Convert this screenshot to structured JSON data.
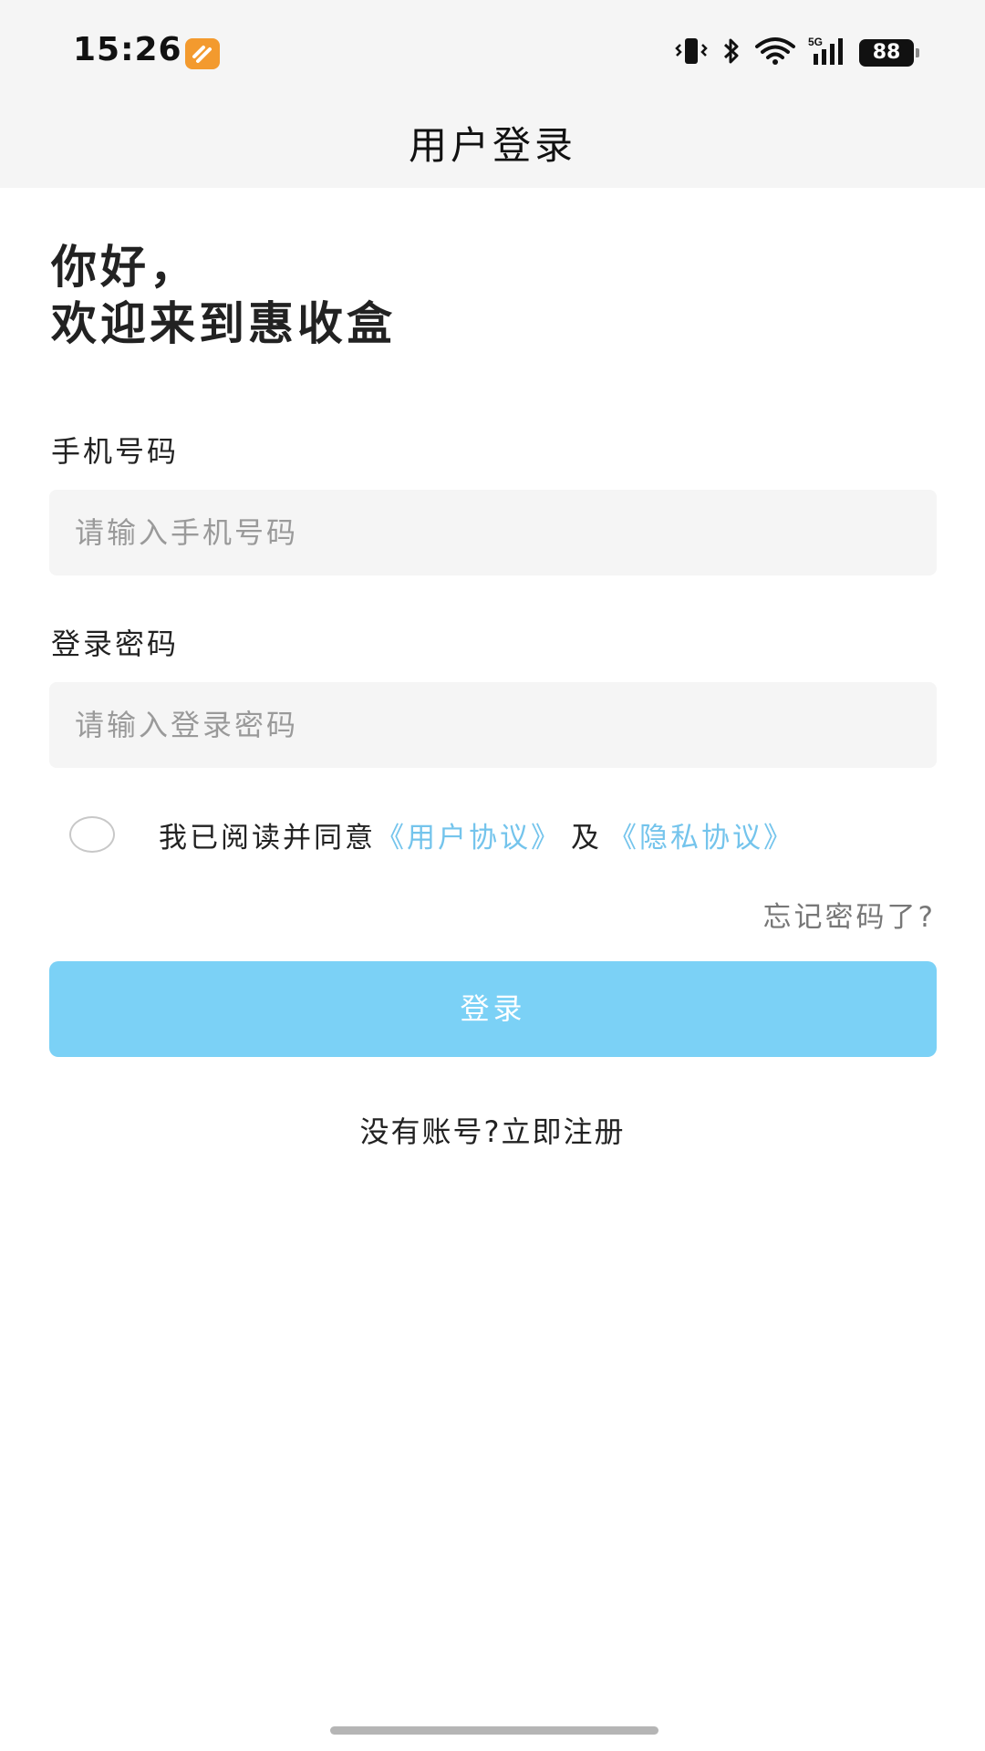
{
  "status_bar": {
    "time": "15:26",
    "battery": "88",
    "network": "5G"
  },
  "nav": {
    "title": "用户登录"
  },
  "greeting": {
    "line1": "你好，",
    "line2": "欢迎来到惠收盒"
  },
  "phone": {
    "label": "手机号码",
    "placeholder": "请输入手机号码",
    "value": ""
  },
  "password": {
    "label": "登录密码",
    "placeholder": "请输入登录密码",
    "value": ""
  },
  "agreement": {
    "prefix": "我已阅读并同意",
    "user_agreement": "《用户协议》",
    "conjunction": "及",
    "privacy_agreement": "《隐私协议》",
    "checked": false
  },
  "forgot_password": "忘记密码了?",
  "login_button": "登录",
  "register_link": "没有账号?立即注册",
  "colors": {
    "accent": "#7bd1f6",
    "link": "#74c4ec",
    "app_icon": "#f39a2e"
  }
}
